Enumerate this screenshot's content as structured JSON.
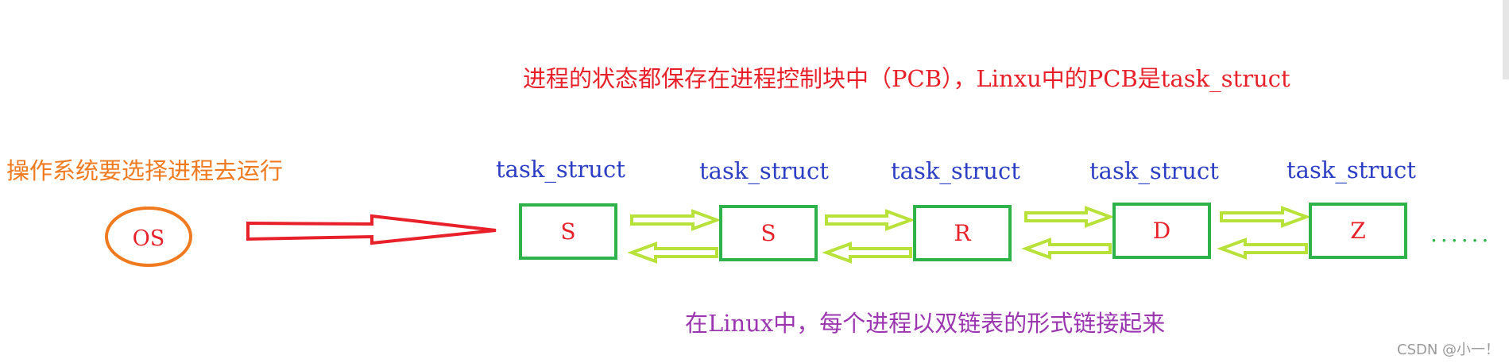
{
  "top_note": "进程的状态都保存在进程控制块中（PCB），Linxu中的PCB是task_struct",
  "os_note": "操作系统要选择进程去运行",
  "os_label": "OS",
  "nodes": [
    {
      "type": "task_struct",
      "state": "S"
    },
    {
      "type": "task_struct",
      "state": "S"
    },
    {
      "type": "task_struct",
      "state": "R"
    },
    {
      "type": "task_struct",
      "state": "D"
    },
    {
      "type": "task_struct",
      "state": "Z"
    }
  ],
  "ellipsis": "......",
  "bottom_note": "在Linux中，每个进程以双链表的形式链接起来",
  "watermark": "CSDN @小一！",
  "colors": {
    "orange": "#f07a20",
    "red": "#e8202a",
    "green": "#2eb34b",
    "lime": "#b8e23a",
    "blue": "#2c3fc4",
    "purple": "#9b35b0"
  }
}
